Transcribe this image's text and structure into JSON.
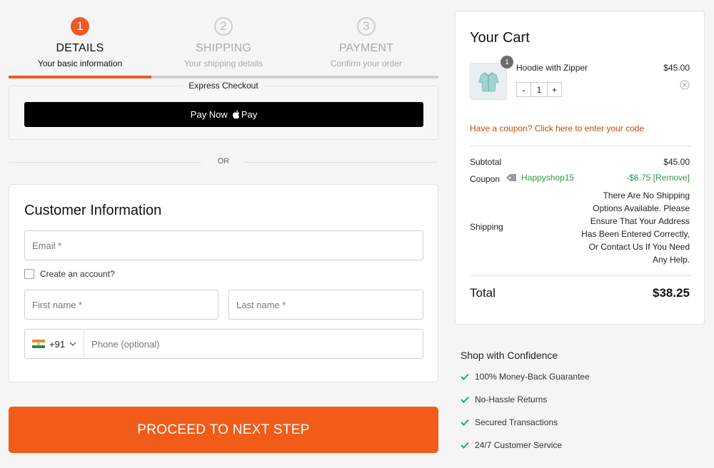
{
  "steps": [
    {
      "number": "1",
      "title": "DETAILS",
      "subtitle": "Your basic information",
      "state": "active"
    },
    {
      "number": "2",
      "title": "SHIPPING",
      "subtitle": "Your shipping details",
      "state": "inactive"
    },
    {
      "number": "3",
      "title": "PAYMENT",
      "subtitle": "Confirm your order",
      "state": "inactive"
    }
  ],
  "express": {
    "label": "Express Checkout",
    "pay_now_label": "Pay Now",
    "pay_brand": "Pay"
  },
  "divider": {
    "or_label": "OR"
  },
  "customer": {
    "heading": "Customer Information",
    "email_placeholder": "Email *",
    "create_account_label": "Create an account?",
    "first_name_placeholder": "First name *",
    "last_name_placeholder": "Last name *",
    "country_code": "+91",
    "phone_placeholder": "Phone (optional)"
  },
  "proceed_label": "PROCEED TO NEXT STEP",
  "cart": {
    "title": "Your Cart",
    "item": {
      "name": "Hoodie with Zipper",
      "price": "$45.00",
      "quantity": "1",
      "badge": "1"
    },
    "coupon_link": "Have a coupon? Click here to enter your code",
    "subtotal_label": "Subtotal",
    "subtotal_value": "$45.00",
    "coupon_label": "Coupon",
    "coupon_code": "Happyshop15",
    "coupon_discount": "-$6.75",
    "coupon_remove": "[Remove]",
    "shipping_label": "Shipping",
    "shipping_message": "There Are No Shipping Options Available. Please Ensure That Your Address Has Been Entered Correctly, Or Contact Us If You Need Any Help.",
    "total_label": "Total",
    "total_value": "$38.25"
  },
  "confidence": {
    "title": "Shop with Confidence",
    "items": [
      "100% Money-Back Guarantee",
      "No-Hassle Returns",
      "Secured Transactions",
      "24/7 Customer Service"
    ]
  },
  "colors": {
    "accent": "#f05a22",
    "success": "#2e9b45",
    "check": "#2a9d8f"
  }
}
